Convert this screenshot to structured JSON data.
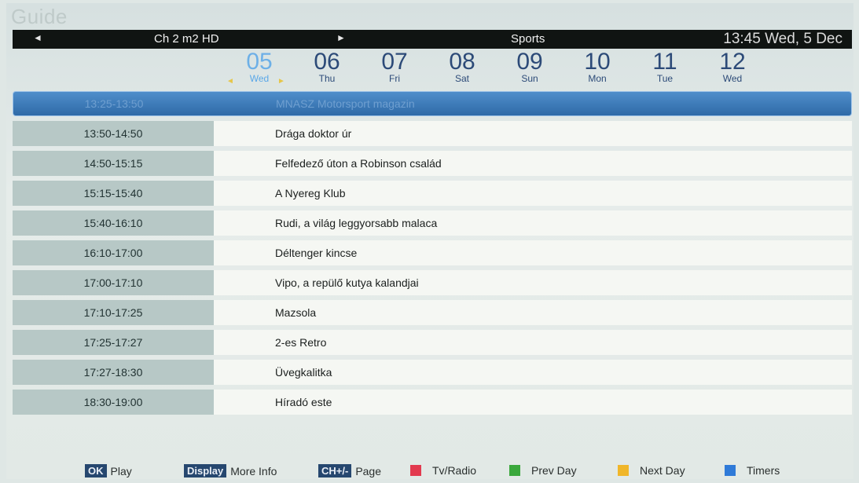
{
  "title": "Guide",
  "topbar": {
    "channel": "Ch 2 m2 HD",
    "genre": "Sports",
    "clock": "13:45 Wed, 5 Dec",
    "left_arrow": "◄",
    "right_arrow": "►"
  },
  "dates": [
    {
      "num": "05",
      "name": "Wed"
    },
    {
      "num": "06",
      "name": "Thu"
    },
    {
      "num": "07",
      "name": "Fri"
    },
    {
      "num": "08",
      "name": "Sat"
    },
    {
      "num": "09",
      "name": "Sun"
    },
    {
      "num": "10",
      "name": "Mon"
    },
    {
      "num": "11",
      "name": "Tue"
    },
    {
      "num": "12",
      "name": "Wed"
    }
  ],
  "selected_date_arrows": {
    "left": "◄",
    "right": "►"
  },
  "schedule": [
    {
      "time": "13:25-13:50",
      "title": "MNASZ Motorsport magazin"
    },
    {
      "time": "13:50-14:50",
      "title": "Drága doktor úr"
    },
    {
      "time": "14:50-15:15",
      "title": "Felfedező úton a Robinson család"
    },
    {
      "time": "15:15-15:40",
      "title": "A Nyereg Klub"
    },
    {
      "time": "15:40-16:10",
      "title": "Rudi, a világ leggyorsabb malaca"
    },
    {
      "time": "16:10-17:00",
      "title": "Déltenger kincse"
    },
    {
      "time": "17:00-17:10",
      "title": "Vipo, a repülő kutya kalandjai"
    },
    {
      "time": "17:10-17:25",
      "title": "Mazsola"
    },
    {
      "time": "17:25-17:27",
      "title": "2-es Retro"
    },
    {
      "time": "17:27-18:30",
      "title": "Üvegkalitka"
    },
    {
      "time": "18:30-19:00",
      "title": "Híradó este"
    }
  ],
  "footer": {
    "ok_key": "OK",
    "ok_label": "Play",
    "display_key": "Display",
    "display_label": "More Info",
    "ch_key": "CH+/-",
    "ch_label": "Page",
    "red_label": "Tv/Radio",
    "green_label": "Prev Day",
    "yellow_label": "Next Day",
    "blue_label": "Timers"
  },
  "colors": {
    "red": "#e23a4f",
    "green": "#3aa83c",
    "yellow": "#f0b62a",
    "blue": "#2f7ad8"
  }
}
